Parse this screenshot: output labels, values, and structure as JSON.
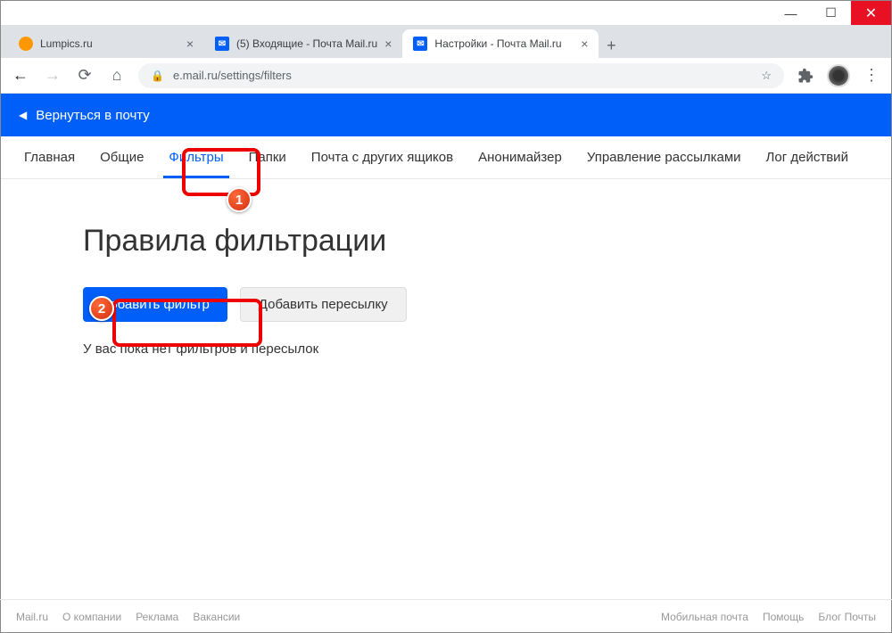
{
  "window": {
    "minimize": "—",
    "maximize": "☐",
    "close": "✕"
  },
  "browser_tabs": [
    {
      "title": "Lumpics.ru",
      "favicon": "orange"
    },
    {
      "title": "(5) Входящие - Почта Mail.ru",
      "favicon": "mail"
    },
    {
      "title": "Настройки - Почта Mail.ru",
      "favicon": "mail",
      "active": true
    }
  ],
  "address_bar": {
    "url": "e.mail.ru/settings/filters"
  },
  "blue_header": {
    "back_label": "Вернуться в почту"
  },
  "settings_tabs": [
    {
      "label": "Главная"
    },
    {
      "label": "Общие"
    },
    {
      "label": "Фильтры",
      "active": true
    },
    {
      "label": "Папки"
    },
    {
      "label": "Почта с других ящиков"
    },
    {
      "label": "Анонимайзер"
    },
    {
      "label": "Управление рассылками"
    },
    {
      "label": "Лог действий"
    }
  ],
  "content": {
    "title": "Правила фильтрации",
    "add_filter_btn": "Добавить фильтр",
    "add_forward_btn": "Добавить пересылку",
    "empty_text": "У вас пока нет фильтров и пересылок"
  },
  "badges": {
    "one": "1",
    "two": "2"
  },
  "footer": {
    "left": [
      "Mail.ru",
      "О компании",
      "Реклама",
      "Вакансии"
    ],
    "right": [
      "Мобильная почта",
      "Помощь",
      "Блог Почты"
    ]
  }
}
